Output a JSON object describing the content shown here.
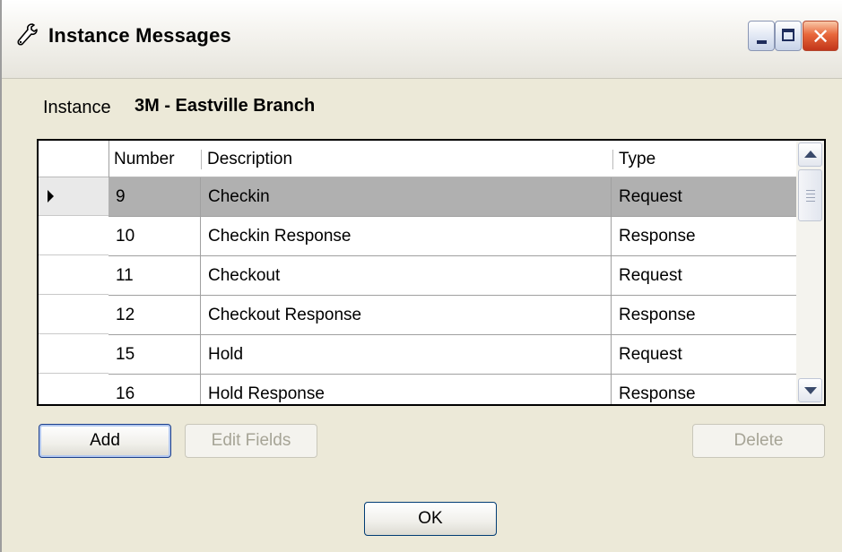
{
  "window": {
    "title": "Instance Messages",
    "controls": {
      "minimize": "_",
      "maximize": "□",
      "close": "✕"
    }
  },
  "instance": {
    "label": "Instance",
    "value": "3M - Eastville Branch"
  },
  "grid": {
    "columns": [
      "Number",
      "Description",
      "Type"
    ],
    "rows": [
      {
        "number": "9",
        "description": "Checkin",
        "type": "Request",
        "selected": true
      },
      {
        "number": "10",
        "description": "Checkin Response",
        "type": "Response"
      },
      {
        "number": "11",
        "description": "Checkout",
        "type": "Request"
      },
      {
        "number": "12",
        "description": "Checkout Response",
        "type": "Response"
      },
      {
        "number": "15",
        "description": "Hold",
        "type": "Request"
      },
      {
        "number": "16",
        "description": "Hold Response",
        "type": "Response"
      }
    ],
    "selected_color": "#b0b0b0"
  },
  "buttons": {
    "add": "Add",
    "edit_fields": "Edit Fields",
    "delete": "Delete",
    "ok": "OK"
  },
  "icons": {
    "title": "wrench-icon",
    "row_indicator": "current-row-arrow-icon",
    "scroll_up": "scroll-up-arrow-icon",
    "scroll_down": "scroll-down-arrow-icon"
  }
}
